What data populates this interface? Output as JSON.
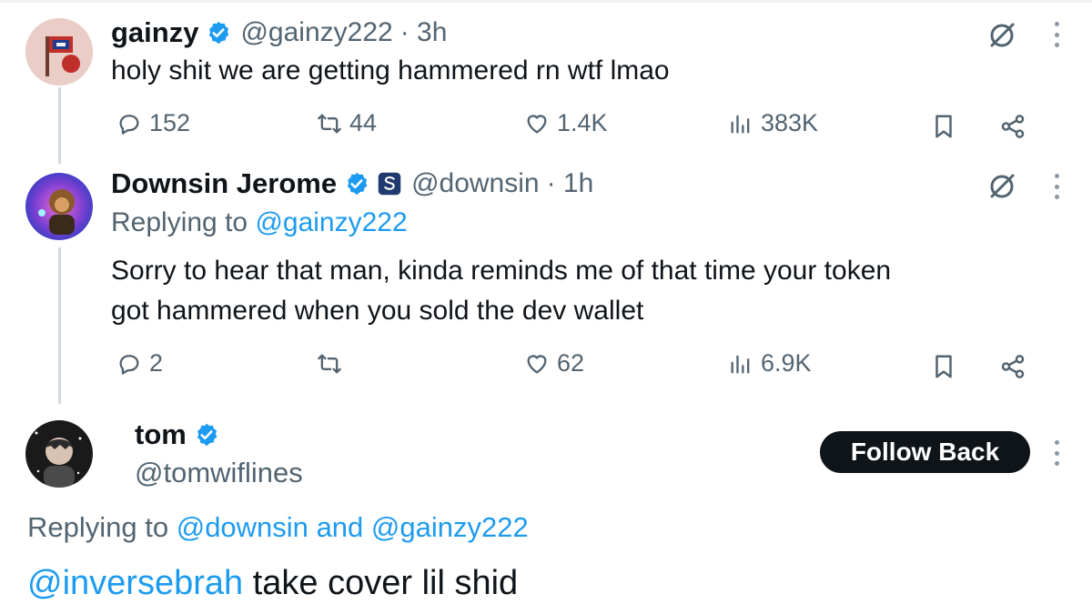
{
  "colors": {
    "accent": "#1d9bf0",
    "text": "#0f1419",
    "muted": "#536471",
    "verified": "#1d9bf0"
  },
  "tweet1": {
    "display_name": "gainzy",
    "handle": "@gainzy222",
    "time": "· 3h",
    "text": "holy shit we are getting hammered rn wtf lmao",
    "replies": "152",
    "reposts": "44",
    "likes": "1.4K",
    "views": "383K"
  },
  "tweet2": {
    "display_name": "Downsin Jerome",
    "handle": "@downsin",
    "time": "· 1h",
    "replying_prefix": "Replying to",
    "replying_handle": "@gainzy222",
    "text_line1": "Sorry to hear that man, kinda reminds me of that time your token",
    "text_line2": "got hammered when you sold the dev wallet",
    "replies": "2",
    "likes": "62",
    "views": "6.9K"
  },
  "tweet3": {
    "display_name": "tom",
    "handle": "@tomwiflines",
    "follow_label": "Follow Back",
    "replying_prefix": "Replying to",
    "replying_handle1": "@downsin",
    "replying_and": "and",
    "replying_handle2": "@gainzy222",
    "mention": "@inversebrah",
    "text": "take cover lil shid"
  },
  "icons": [
    "verified-badge-icon",
    "grok-icon",
    "more-icon",
    "reply-icon",
    "repost-icon",
    "like-icon",
    "views-icon",
    "bookmark-icon",
    "share-icon",
    "affiliate-badge-icon"
  ]
}
